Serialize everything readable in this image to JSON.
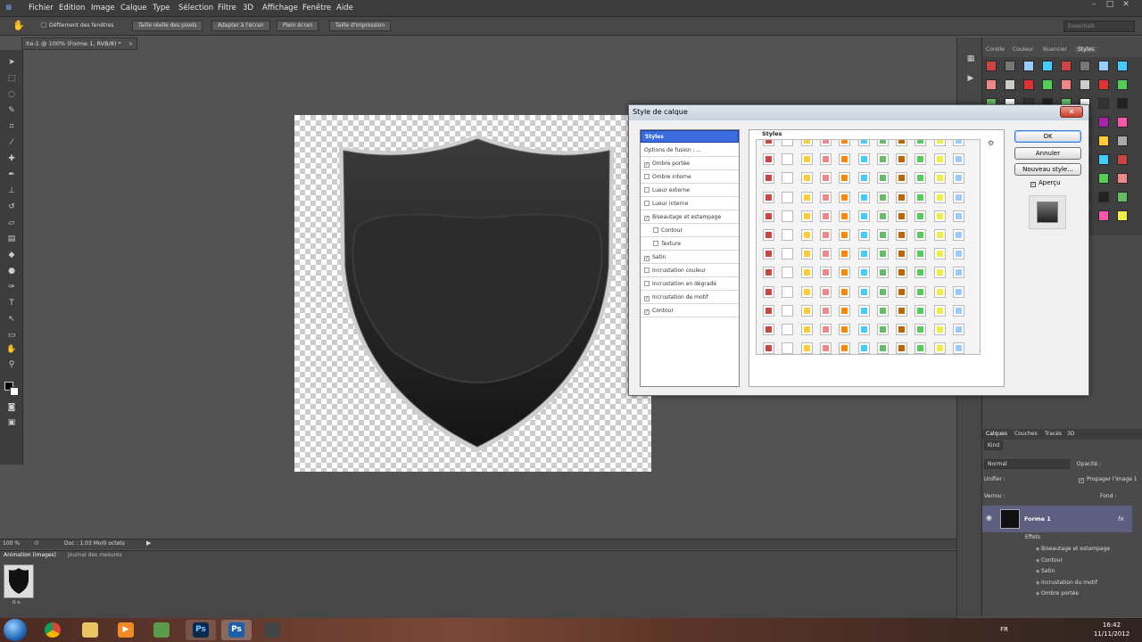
{
  "menubar": {
    "items": [
      "Fichier",
      "Edition",
      "Image",
      "Calque",
      "Type",
      "Sélection",
      "Filtre",
      "3D",
      "Affichage",
      "Fenêtre",
      "Aide"
    ]
  },
  "optbar": {
    "scroll_all_label": "Défilement des fenêtres",
    "buttons": [
      "Taille réelle des pixels",
      "Adapter à l'écran",
      "Plein écran",
      "Taille d'impression"
    ],
    "workspace": "Essentials"
  },
  "doc_tab": "Ite-1 @ 100% (Forme 1, RVB/8) *",
  "status": {
    "zoom": "100 %",
    "doc": "Doc : 1,03 Mo/0 octets"
  },
  "anim": {
    "tab1": "Animation (images)",
    "tab2": "Journal des mesures",
    "frame_time": "0 s."
  },
  "right_panel": {
    "tabs": [
      "Corelle",
      "Couleur",
      "Nuancier",
      "Styles"
    ],
    "layers_tabs": [
      "Calques",
      "Couches",
      "Tracés",
      "3D"
    ],
    "kind": "Kind",
    "blend_mode": "Normal",
    "opacity_label": "Opacité :",
    "unify_label": "Unifier :",
    "propagate_label": "Propager l'image 1",
    "lock_label": "Verrou :",
    "fill_label": "Fond :",
    "layer_name": "Forme 1",
    "fx": "fx",
    "effects_label": "Effets",
    "effects": [
      "Biseautage et estampage",
      "Contour",
      "Satin",
      "Incrustation du motif",
      "Ombre portée"
    ]
  },
  "dialog": {
    "title": "Style de calque",
    "close": "✕",
    "left_header": "Styles",
    "blend_options": "Options de fusion : ...",
    "left_items": [
      {
        "label": "Ombre portée",
        "checked": "✓"
      },
      {
        "label": "Ombre interne",
        "checked": ""
      },
      {
        "label": "Lueur externe",
        "checked": ""
      },
      {
        "label": "Lueur interne",
        "checked": ""
      },
      {
        "label": "Biseautage et estampage",
        "checked": "✓"
      },
      {
        "label": "Contour",
        "checked": ""
      },
      {
        "label": "Texture",
        "checked": ""
      },
      {
        "label": "Satin",
        "checked": "✓"
      },
      {
        "label": "Incrustation couleur",
        "checked": ""
      },
      {
        "label": "Incrustation en dégradé",
        "checked": ""
      },
      {
        "label": "Incrustation de motif",
        "checked": "✓"
      },
      {
        "label": "Contour",
        "checked": "✓"
      }
    ],
    "styles_label": "Styles",
    "ok": "OK",
    "cancel": "Annuler",
    "new_style": "Nouveau style...",
    "preview": "Aperçu",
    "preview_check": "✓"
  },
  "taskbar": {
    "lang": "FR",
    "time": "16:42",
    "date": "11/11/2012",
    "ps_label": "Ps"
  }
}
